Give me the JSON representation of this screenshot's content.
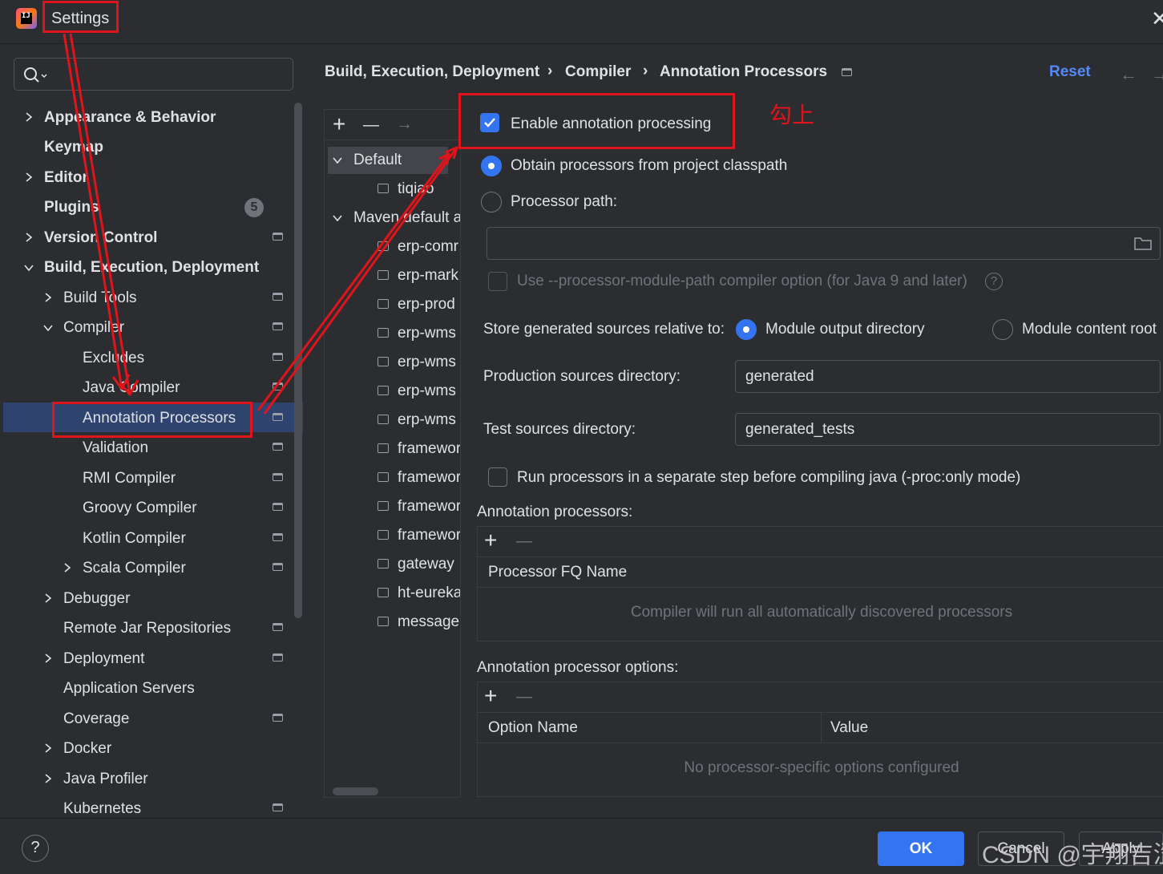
{
  "window": {
    "title": "Settings",
    "close_glyph": "✕"
  },
  "search": {
    "placeholder": ""
  },
  "tree": {
    "appearance": "Appearance & Behavior",
    "keymap": "Keymap",
    "editor": "Editor",
    "plugins": "Plugins",
    "plugins_badge": "5",
    "version_control": "Version Control",
    "build": "Build, Execution, Deployment",
    "build_tools": "Build Tools",
    "compiler": "Compiler",
    "excludes": "Excludes",
    "java_compiler": "Java Compiler",
    "annotation_processors": "Annotation Processors",
    "validation": "Validation",
    "rmi_compiler": "RMI Compiler",
    "groovy_compiler": "Groovy Compiler",
    "kotlin_compiler": "Kotlin Compiler",
    "scala_compiler": "Scala Compiler",
    "debugger": "Debugger",
    "remote_jar": "Remote Jar Repositories",
    "deployment": "Deployment",
    "app_servers": "Application Servers",
    "coverage": "Coverage",
    "docker": "Docker",
    "java_profiler": "Java Profiler",
    "kubernetes": "Kubernetes"
  },
  "breadcrumb": {
    "part1": "Build, Execution, Deployment",
    "part2": "Compiler",
    "part3": "Annotation Processors",
    "separator": "›",
    "reset": "Reset",
    "back_glyph": "←",
    "forward_glyph": "→"
  },
  "profiles": {
    "add_glyph": "+",
    "remove_glyph": "—",
    "move_glyph": "→",
    "default": "Default",
    "tiqiao": "tiqiao",
    "maven_default": "Maven default a",
    "modules": [
      "erp-comr",
      "erp-mark",
      "erp-prod",
      "erp-wms",
      "erp-wms",
      "erp-wms",
      "erp-wms",
      "framewor",
      "framewor",
      "framewor",
      "framewor",
      "gateway",
      "ht-eureka",
      "message-"
    ]
  },
  "form": {
    "enable_annotation": "Enable annotation processing",
    "enable_checked": true,
    "annotation_note": "勾上",
    "obtain_classpath": "Obtain processors from project classpath",
    "processor_path": "Processor path:",
    "processor_path_value": "",
    "module_path_option": "Use --processor-module-path compiler option (for Java 9 and later)",
    "store_label": "Store generated sources relative to:",
    "module_output": "Module output directory",
    "module_content": "Module content root",
    "prod_dir_label": "Production sources directory:",
    "prod_dir_value": "generated",
    "test_dir_label": "Test sources directory:",
    "test_dir_value": "generated_tests",
    "run_separate": "Run processors in a separate step before compiling java (-proc:only mode)"
  },
  "processors_table": {
    "title": "Annotation processors:",
    "add_glyph": "+",
    "remove_glyph": "—",
    "column": "Processor FQ Name",
    "empty_text": "Compiler will run all automatically discovered processors"
  },
  "options_table": {
    "title": "Annotation processor options:",
    "add_glyph": "+",
    "remove_glyph": "—",
    "col_name": "Option Name",
    "col_value": "Value",
    "empty_text": "No processor-specific options configured"
  },
  "footer": {
    "help": "?",
    "ok": "OK",
    "cancel": "Cancel",
    "apply": "Apply"
  },
  "watermark": "CSDN @宇翔吉涩",
  "colors": {
    "accent": "#3574f0",
    "annotation_red": "#e0141b",
    "background": "#2b2d30",
    "selection": "#2e436e"
  },
  "icons": [
    "app-logo-icon",
    "search-icon",
    "chevron-right-icon",
    "chevron-down-icon",
    "pin-icon",
    "folder-icon",
    "module-icon",
    "help-icon",
    "check-icon"
  ]
}
